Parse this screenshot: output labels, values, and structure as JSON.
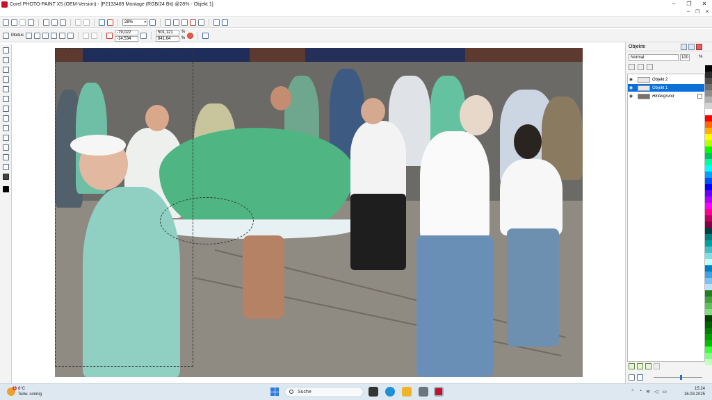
{
  "window": {
    "title": "Corel PHOTO-PAINT X5 (OEM-Version) - [P2133469 Montage (RGB/24 Bit) @28% - Objekt 1]",
    "controls": [
      "–",
      "❐",
      "✕"
    ],
    "mdi_controls": [
      "–",
      "❐",
      "✕"
    ]
  },
  "toolbar": {
    "zoom_value": "28%"
  },
  "property_bar": {
    "mode_label": "Modus",
    "pos_x": "-79,022",
    "pos_y": "-14,534",
    "width": "501,121",
    "height": "841,64",
    "unit_w": "%",
    "unit_h": "%"
  },
  "objects_docker": {
    "title": "Objekte",
    "blend_mode": "Normal",
    "opacity": "100",
    "opacity_unit": "%",
    "layers": [
      {
        "name": "Objekt 2",
        "selected": false
      },
      {
        "name": "Objekt 1",
        "selected": true
      },
      {
        "name": "Hintergrund",
        "selected": false
      }
    ]
  },
  "palette": [
    "#000000",
    "#2a2a2a",
    "#4d4d4d",
    "#6e6e6e",
    "#8f8f8f",
    "#b1b1b1",
    "#d3d3d3",
    "#ffffff",
    "#ff0000",
    "#ff6a00",
    "#ffb000",
    "#ffff00",
    "#b6ff00",
    "#00ff00",
    "#00c060",
    "#00ff9a",
    "#00ffff",
    "#00a0ff",
    "#0050ff",
    "#0000ff",
    "#6a00ff",
    "#b000ff",
    "#ff00ff",
    "#ff0090",
    "#c00060",
    "#800040",
    "#004040",
    "#008080",
    "#00a0a0",
    "#40c0c0",
    "#80e0e0",
    "#c0ffff",
    "#0080c0",
    "#40a0e0",
    "#80c0f0",
    "#c0e0ff",
    "#208020",
    "#40a040",
    "#60c060",
    "#80e080",
    "#004000",
    "#006000",
    "#008000",
    "#00a000",
    "#00c000",
    "#40ff40",
    "#80ff80",
    "#c0ffc0"
  ],
  "taskbar": {
    "weather_temp": "8°C",
    "weather_desc": "Teilw. sonnig",
    "weather_badge": "1",
    "search_placeholder": "Suche",
    "time": "15:24",
    "date": "16.03.2025"
  }
}
